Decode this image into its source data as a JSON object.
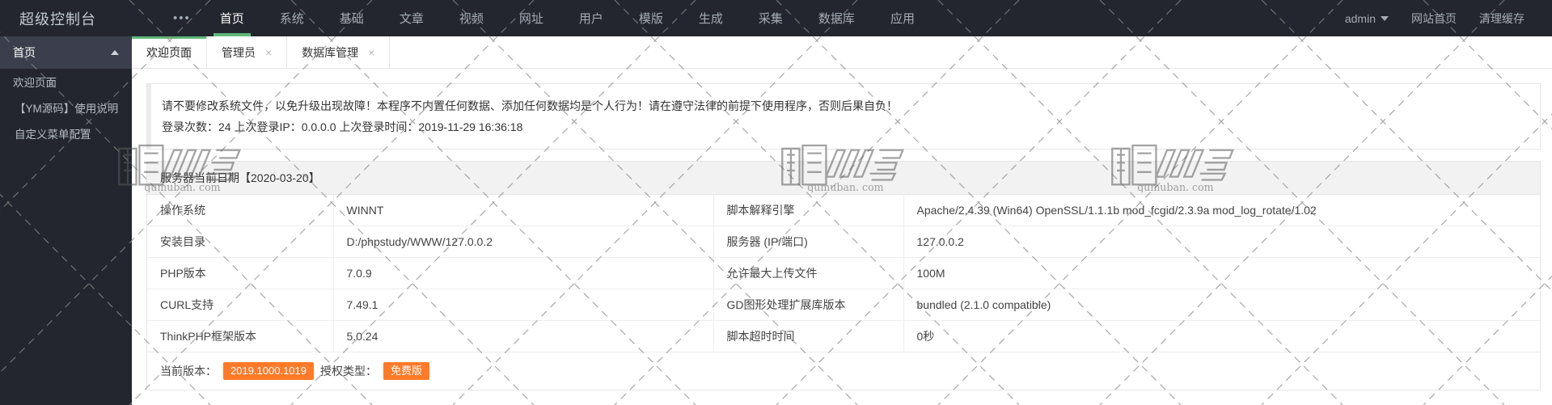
{
  "header": {
    "logo": "超级控制台",
    "more_icon": "•••",
    "nav": [
      {
        "label": "首页",
        "active": true
      },
      {
        "label": "系统",
        "active": false
      },
      {
        "label": "基础",
        "active": false
      },
      {
        "label": "文章",
        "active": false
      },
      {
        "label": "视频",
        "active": false
      },
      {
        "label": "网址",
        "active": false
      },
      {
        "label": "用户",
        "active": false
      },
      {
        "label": "模版",
        "active": false
      },
      {
        "label": "生成",
        "active": false
      },
      {
        "label": "采集",
        "active": false
      },
      {
        "label": "数据库",
        "active": false
      },
      {
        "label": "应用",
        "active": false
      }
    ],
    "right": [
      {
        "label": "admin",
        "caret": true
      },
      {
        "label": "网站首页",
        "caret": false
      },
      {
        "label": "清理缓存",
        "caret": false
      }
    ]
  },
  "sidebar": {
    "title": "首页",
    "items": [
      {
        "label": "欢迎页面"
      },
      {
        "label": "【YM源码】使用说明"
      },
      {
        "label": "自定义菜单配置"
      }
    ]
  },
  "tabs": [
    {
      "label": "欢迎页面",
      "active": true,
      "closable": false
    },
    {
      "label": "管理员",
      "active": false,
      "closable": true
    },
    {
      "label": "数据库管理",
      "active": false,
      "closable": true
    }
  ],
  "tab_close_icon": "×",
  "notice": {
    "line1": "请不要修改系统文件，以免升级出现故障！本程序不内置任何数据、添加任何数据均是个人行为！请在遵守法律的前提下使用程序，否则后果自负！",
    "line2": "登录次数：24 上次登录IP：0.0.0.0 上次登录时间：2019-11-29 16:36:18"
  },
  "panel": {
    "head": "服务器当前日期【2020-03-20】",
    "rows": [
      {
        "k1": "操作系统",
        "v1": "WINNT",
        "k2": "脚本解释引擎",
        "v2": "Apache/2.4.39 (Win64) OpenSSL/1.1.1b mod_fcgid/2.3.9a mod_log_rotate/1.02"
      },
      {
        "k1": "安装目录",
        "v1": "D:/phpstudy/WWW/127.0.0.2",
        "k2": "服务器 (IP/端口)",
        "v2": "127.0.0.2"
      },
      {
        "k1": "PHP版本",
        "v1": "7.0.9",
        "k2": "允许最大上传文件",
        "v2": "100M"
      },
      {
        "k1": "CURL支持",
        "v1": "7.49.1",
        "k2": "GD图形处理扩展库版本",
        "v2": "bundled (2.1.0 compatible)"
      },
      {
        "k1": "ThinkPHP框架版本",
        "v1": "5.0.24",
        "k2": "脚本超时时间",
        "v2": "0秒"
      }
    ],
    "version_label": "当前版本：",
    "version_value": "2019.1000.1019",
    "license_label": "授权类型：",
    "license_value": "免费版"
  },
  "watermark": {
    "text": "qumuban. com",
    "mark": "MB",
    "colors": {
      "accent_green": "#5fb878",
      "badge_orange": "#ff7a29",
      "header_bg": "#23262e"
    }
  }
}
